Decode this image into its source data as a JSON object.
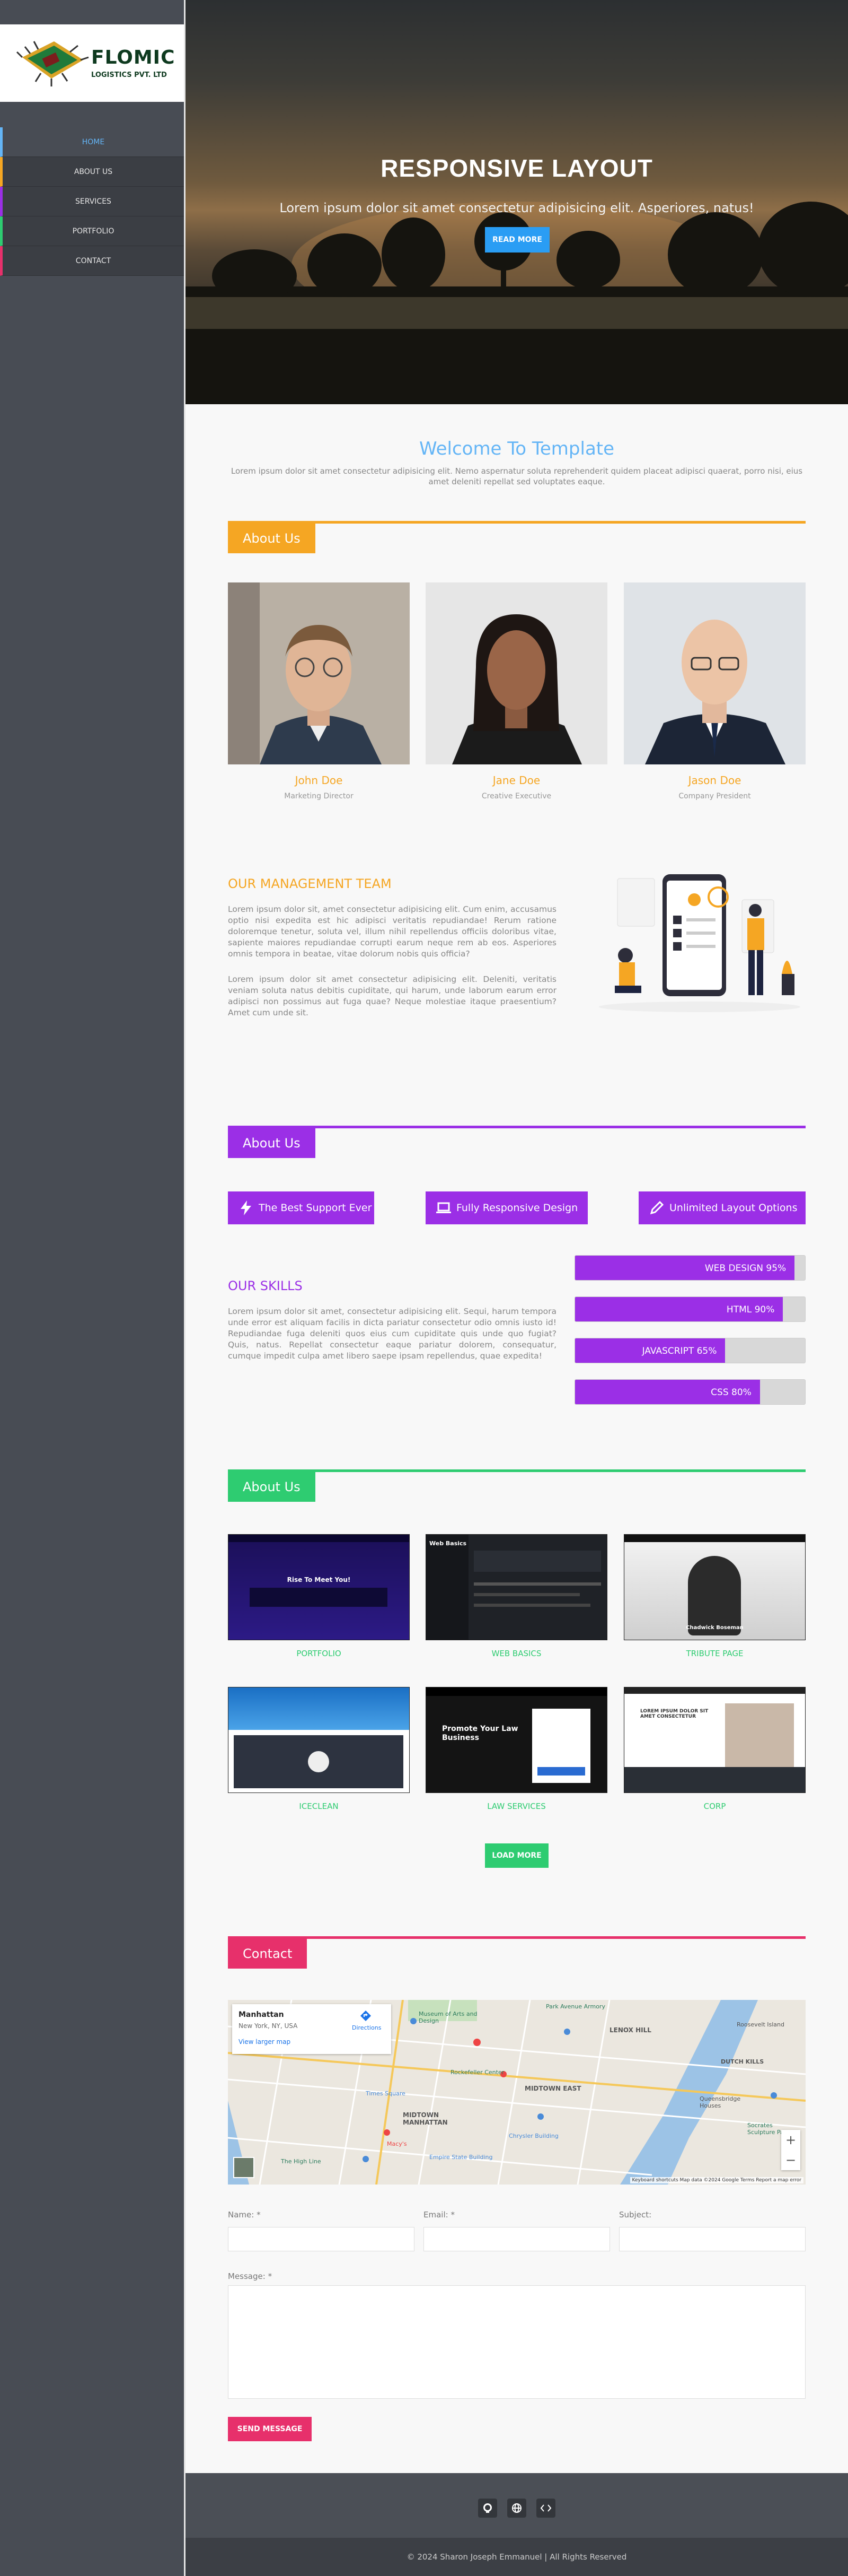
{
  "sidebar": {
    "logo_name": "FLOMIC",
    "logo_sub": "LOGISTICS PVT. LTD",
    "nav": [
      {
        "label": "HOME",
        "accent": "#64b5f6"
      },
      {
        "label": "ABOUT US",
        "accent": "#f5a623"
      },
      {
        "label": "SERVICES",
        "accent": "#9b2fe6"
      },
      {
        "label": "PORTFOLIO",
        "accent": "#2ecc71"
      },
      {
        "label": "CONTACT",
        "accent": "#e7306b"
      }
    ]
  },
  "hero": {
    "title": "RESPONSIVE LAYOUT",
    "subtitle": "Lorem ipsum dolor sit amet consectetur adipisicing elit. Asperiores, natus!",
    "button": "READ MORE"
  },
  "welcome": {
    "title": "Welcome To Template",
    "text": "Lorem ipsum dolor sit amet consectetur adipisicing elit. Nemo aspernatur soluta reprehenderit quidem placeat adipisci quaerat, porro nisi, eius amet deleniti repellat sed voluptates eaque."
  },
  "about": {
    "tag": "About Us",
    "color": "#f5a623",
    "team": [
      {
        "name": "John Doe",
        "role": "Marketing Director"
      },
      {
        "name": "Jane Doe",
        "role": "Creative Executive"
      },
      {
        "name": "Jason Doe",
        "role": "Company President"
      }
    ],
    "mgmt_title": "OUR MANAGEMENT TEAM",
    "p1": "Lorem ipsum dolor sit, amet consectetur adipisicing elit. Cum enim, accusamus optio nisi expedita est hic adipisci veritatis repudiandae! Rerum ratione doloremque tenetur, soluta vel, illum nihil repellendus officiis doloribus vitae, sapiente maiores repudiandae corrupti earum neque rem ab eos. Asperiores omnis tempora in beatae, vitae dolorum nobis quis officia?",
    "p2": "Lorem ipsum dolor sit amet consectetur adipisicing elit. Deleniti, veritatis veniam soluta natus debitis cupiditate, qui harum, unde laborum earum error adipisci non possimus aut fuga quae? Neque molestiae itaque praesentium? Amet cum unde sit."
  },
  "services": {
    "tag": "About Us",
    "color": "#9b2fe6",
    "features": [
      {
        "label": "The Best Support Ever",
        "icon": "bolt-icon"
      },
      {
        "label": "Fully Responsive Design",
        "icon": "laptop-icon"
      },
      {
        "label": "Unlimited Layout Options",
        "icon": "pencil-icon"
      }
    ],
    "skills_title": "OUR SKILLS",
    "skills_text": "Lorem ipsum dolor sit amet, consectetur adipisicing elit. Sequi, harum tempora unde error est aliquam facilis in dicta pariatur consectetur odio omnis iusto id! Repudiandae fuga deleniti quos eius cum cupiditate quis unde quo fugiat? Quis, natus. Repellat consectetur eaque pariatur dolorem, consequatur, cumque impedit culpa amet libero saepe ipsam repellendus, quae expedita!",
    "skills": [
      {
        "label": "WEB DESIGN 95%",
        "value": 95
      },
      {
        "label": "HTML  90%",
        "value": 90
      },
      {
        "label": "JAVASCRIPT  65%",
        "value": 65
      },
      {
        "label": "CSS 80%",
        "value": 80
      }
    ]
  },
  "portfolio": {
    "tag": "About Us",
    "color": "#2ecc71",
    "items": [
      {
        "caption": "PORTFOLIO",
        "thumb_text": "Rise To Meet You!"
      },
      {
        "caption": "WEB BASICS",
        "thumb_text": "Web Basics"
      },
      {
        "caption": "TRIBUTE PAGE",
        "thumb_text": "Chadwick Boseman"
      },
      {
        "caption": "ICECLEAN",
        "thumb_text": ""
      },
      {
        "caption": "LAW SERVICES",
        "thumb_text": "Promote Your Law Business"
      },
      {
        "caption": "CORP",
        "thumb_text": "LOREM IPSUM DOLOR SIT AMET CONSECTETUR"
      }
    ],
    "load_more": "LOAD MORE"
  },
  "contact": {
    "tag": "Contact",
    "color": "#e7306b",
    "map": {
      "place": "Manhattan",
      "address": "New York, NY, USA",
      "directions": "Directions",
      "larger": "View larger map",
      "labels": [
        "Museum of Arts and Design",
        "Park Avenue Armory",
        "LENOX HILL",
        "Rockefeller Center",
        "MIDTOWN EAST",
        "MIDTOWN MANHATTAN",
        "Chrysler Building",
        "Empire State Building",
        "Macy's",
        "The High Line",
        "Times Square",
        "DUTCH KILLS",
        "Queensbridge Houses",
        "Roosevelt Island",
        "Socrates Sculpture Park"
      ],
      "footer": "Keyboard shortcuts   Map data ©2024 Google   Terms   Report a map error"
    },
    "name_label": "Name: *",
    "email_label": "Email: *",
    "subject_label": "Subject:",
    "message_label": "Message: *",
    "send": "SEND MESSAGE"
  },
  "footer": {
    "icons": [
      "github-icon",
      "globe-icon",
      "code-icon"
    ],
    "copyright": "© 2024 Sharon Joseph Emmanuel | All Rights Reserved"
  }
}
